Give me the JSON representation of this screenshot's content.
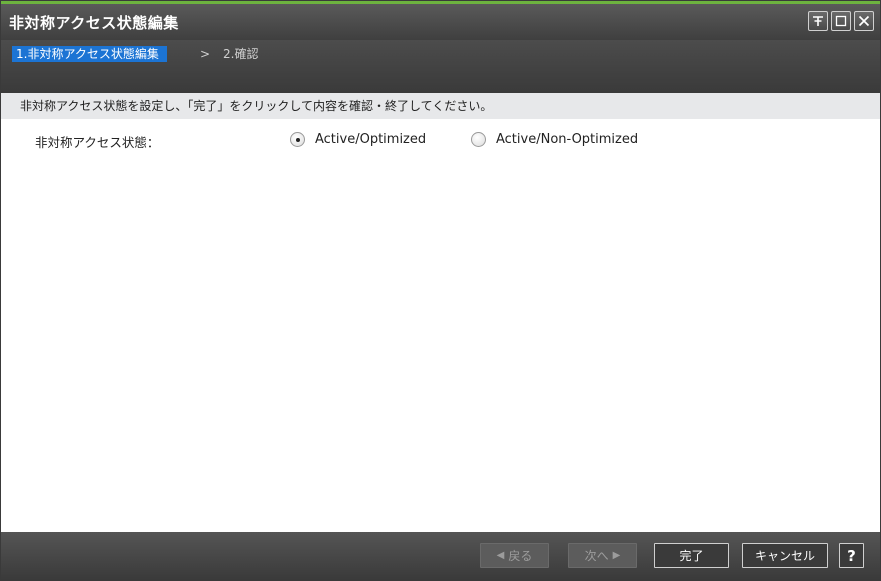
{
  "window": {
    "title": "非対称アクセス状態編集",
    "controls": [
      "pin-icon",
      "maximize-icon",
      "close-icon"
    ]
  },
  "wizard": {
    "current_step": "1.非対称アクセス状態編集",
    "separator": ">",
    "next_step": "2.確認"
  },
  "instructions": "非対称アクセス状態を設定し、「完了」をクリックして内容を確認・終了してください。",
  "form": {
    "label": "非対称アクセス状態：",
    "options": [
      {
        "label": "Active/Optimized",
        "checked": true
      },
      {
        "label": "Active/Non-Optimized",
        "checked": false
      }
    ]
  },
  "footer": {
    "back": "戻る",
    "next": "次へ",
    "finish": "完了",
    "cancel": "キャンセル",
    "help": "?"
  },
  "colors": {
    "accent": "#6db33f",
    "step_highlight": "#1c74d4",
    "titlebar": "#4a4a4a"
  }
}
